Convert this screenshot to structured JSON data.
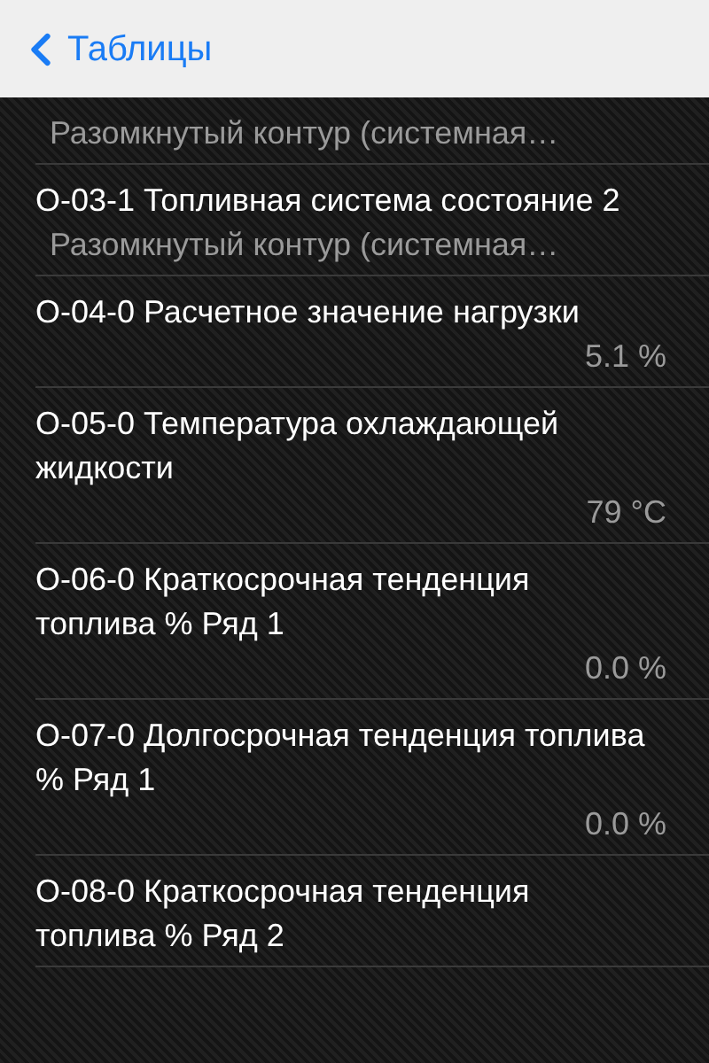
{
  "nav_bar": {
    "back_button": "Таблицы"
  },
  "rows": [
    {
      "kind": "detail",
      "detail": "Разомкнутый контур (системная…"
    },
    {
      "kind": "detail",
      "title": "О-03-1 Топливная система состояние 2",
      "detail": "Разомкнутый контур (системная…"
    },
    {
      "kind": "value",
      "title": "О-04-0 Расчетное значение нагрузки",
      "value": "5.1 %"
    },
    {
      "kind": "value",
      "title": "О-05-0 Температура охлаждающей жидкости",
      "value": "79 °C"
    },
    {
      "kind": "value",
      "title": "О-06-0 Краткосрочная тенденция топлива % Ряд 1",
      "value": "0.0 %"
    },
    {
      "kind": "value",
      "title": "О-07-0 Долгосрочная тенденция топлива % Ряд 1",
      "value": "0.0 %"
    },
    {
      "kind": "value",
      "title": "О-08-0 Краткосрочная тенденция топлива % Ряд 2"
    }
  ]
}
